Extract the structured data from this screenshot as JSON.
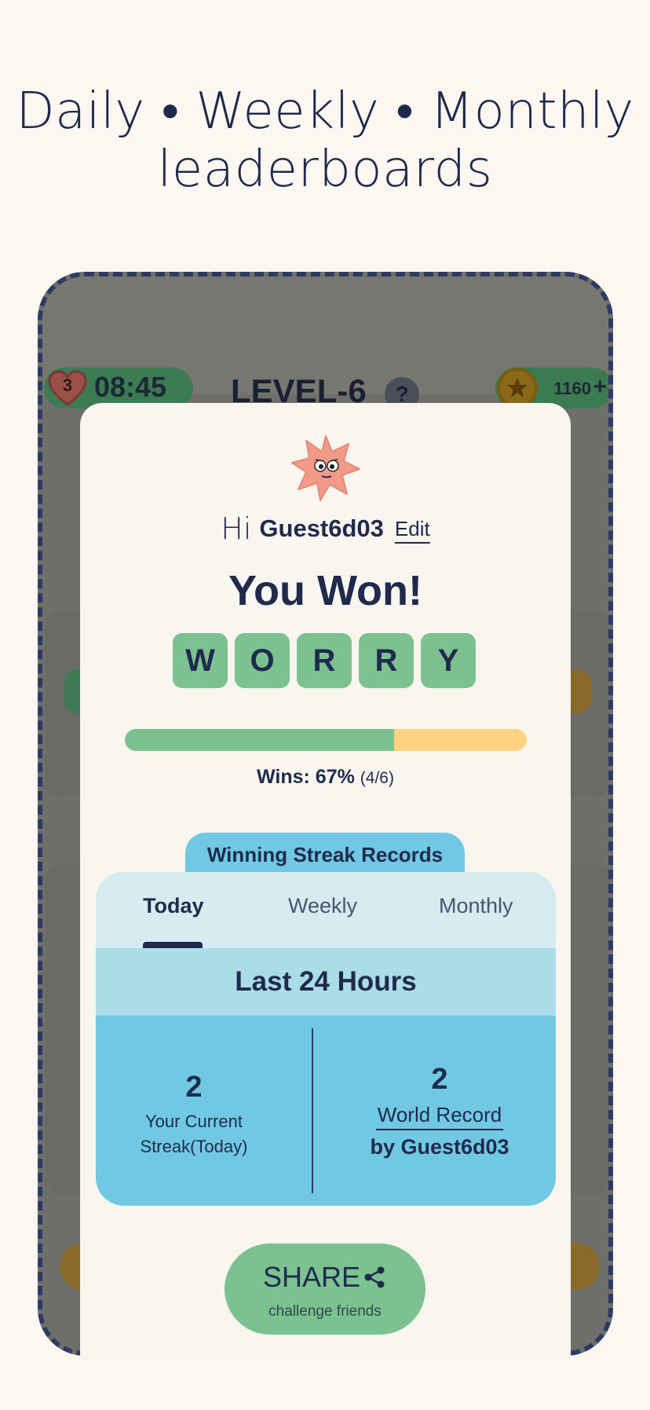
{
  "headline": {
    "line1": "Daily • Weekly • Monthly",
    "line2": "leaderboards"
  },
  "game_header": {
    "lives": "3",
    "timer": "08:45",
    "level": "LEVEL-6",
    "help": "?",
    "coins": "1160",
    "coins_add": "+"
  },
  "modal": {
    "greeting": "Hi",
    "username": "Guest6d03",
    "edit_label": "Edit",
    "result_title": "You Won!",
    "word_tiles": [
      "W",
      "O",
      "R",
      "R",
      "Y"
    ],
    "win_progress": 0.67,
    "wins_label": "Wins:",
    "wins_percent": "67%",
    "wins_ratio": "(4/6)",
    "streak_title": "Winning Streak Records",
    "tabs": [
      "Today",
      "Weekly",
      "Monthly"
    ],
    "active_tab": "Today",
    "period_label": "Last 24 Hours",
    "current_streak": {
      "value": "2",
      "caption_line1": "Your Current",
      "caption_line2": "Streak(Today)"
    },
    "world_record": {
      "value": "2",
      "label": "World Record",
      "by": "by Guest6d03"
    },
    "share": {
      "label": "SHARE",
      "sub": "challenge friends"
    }
  },
  "colors": {
    "navy": "#1f2a4d",
    "green": "#7cc290",
    "yellow": "#fdd282",
    "blue": "#71c8e2",
    "cream": "#fcf7f1"
  }
}
